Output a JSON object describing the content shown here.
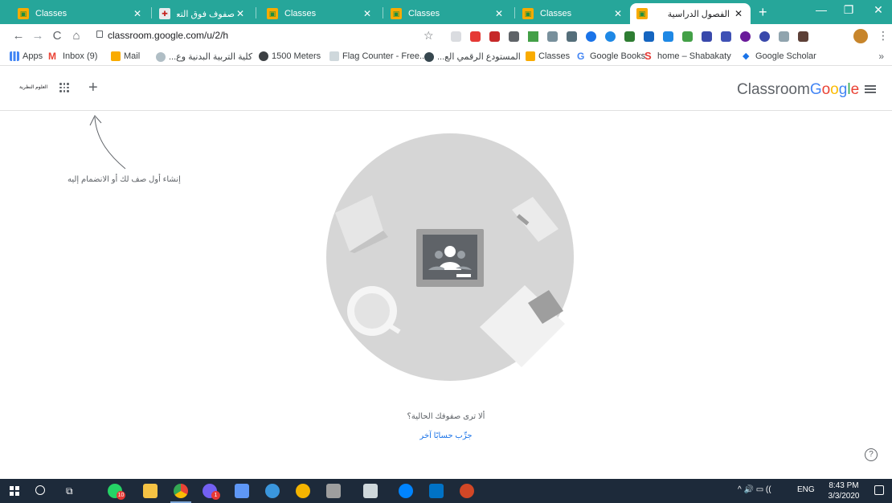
{
  "colors": {
    "tabstrip": "#26a69a",
    "taskbar": "#1d2a3a",
    "link": "#1a73e8"
  },
  "tabs": [
    {
      "title": "Classes",
      "active": false
    },
    {
      "title": "صفوف فوق التعليمية ...",
      "active": false
    },
    {
      "title": "Classes",
      "active": false
    },
    {
      "title": "Classes",
      "active": false
    },
    {
      "title": "Classes",
      "active": false
    },
    {
      "title": "الفصول الدراسية",
      "active": true
    }
  ],
  "new_tab_label": "+",
  "window_controls": {
    "minimize": "—",
    "restore": "❐",
    "close": "✕"
  },
  "nav": {
    "back": "←",
    "forward": "→",
    "reload": "C",
    "home": "⌂"
  },
  "address": {
    "url": "classroom.google.com/u/2/h"
  },
  "bookmarks": [
    {
      "label": "Apps",
      "icon": "apps-grid-icon"
    },
    {
      "label": "Inbox (9)",
      "icon": "gmail-icon"
    },
    {
      "label": "Mail",
      "icon": "mail-icon"
    },
    {
      "label": "كلية التربية البدنية وع...",
      "icon": "college-icon"
    },
    {
      "label": "1500 Meters",
      "icon": "globe-icon"
    },
    {
      "label": "Flag Counter - Free...",
      "icon": "flag-counter-icon"
    },
    {
      "label": "المستودع الرقمي الع...",
      "icon": "repository-icon"
    },
    {
      "label": "Classes",
      "icon": "classroom-icon"
    },
    {
      "label": "Google Books",
      "icon": "google-icon"
    },
    {
      "label": "home – Shabakaty",
      "icon": "shabakaty-icon"
    },
    {
      "label": "Google Scholar",
      "icon": "scholar-icon"
    }
  ],
  "bookmarks_more": "»",
  "header": {
    "account_label": "العلوم النظرية",
    "add_label": "+",
    "brand_classroom": "Classroom",
    "brand_google": [
      "G",
      "o",
      "o",
      "g",
      "l",
      "e"
    ]
  },
  "empty_state": {
    "hint": "إنشاء أول صف لك أو الانضمام إليه",
    "question": "ألا ترى صفوفك الحالية؟",
    "switch_account": "جرِّب حسابًا آخر"
  },
  "help_label": "?",
  "taskbar": {
    "apps": [
      {
        "name": "whatsapp-icon",
        "badge": "10"
      },
      {
        "name": "file-explorer-icon"
      },
      {
        "name": "chrome-icon"
      },
      {
        "name": "viber-icon",
        "badge": "1"
      },
      {
        "name": "notes-icon"
      },
      {
        "name": "edge-icon"
      },
      {
        "name": "paint-icon"
      },
      {
        "name": "snipping-icon"
      },
      {
        "name": "calculator-icon"
      },
      {
        "name": "messenger-icon"
      },
      {
        "name": "outlook-icon"
      },
      {
        "name": "powerpoint-icon"
      }
    ],
    "tray_icons": "^ 🔊 ▭ ((",
    "language": "ENG",
    "time": "8:43 PM",
    "date": "3/3/2020"
  }
}
